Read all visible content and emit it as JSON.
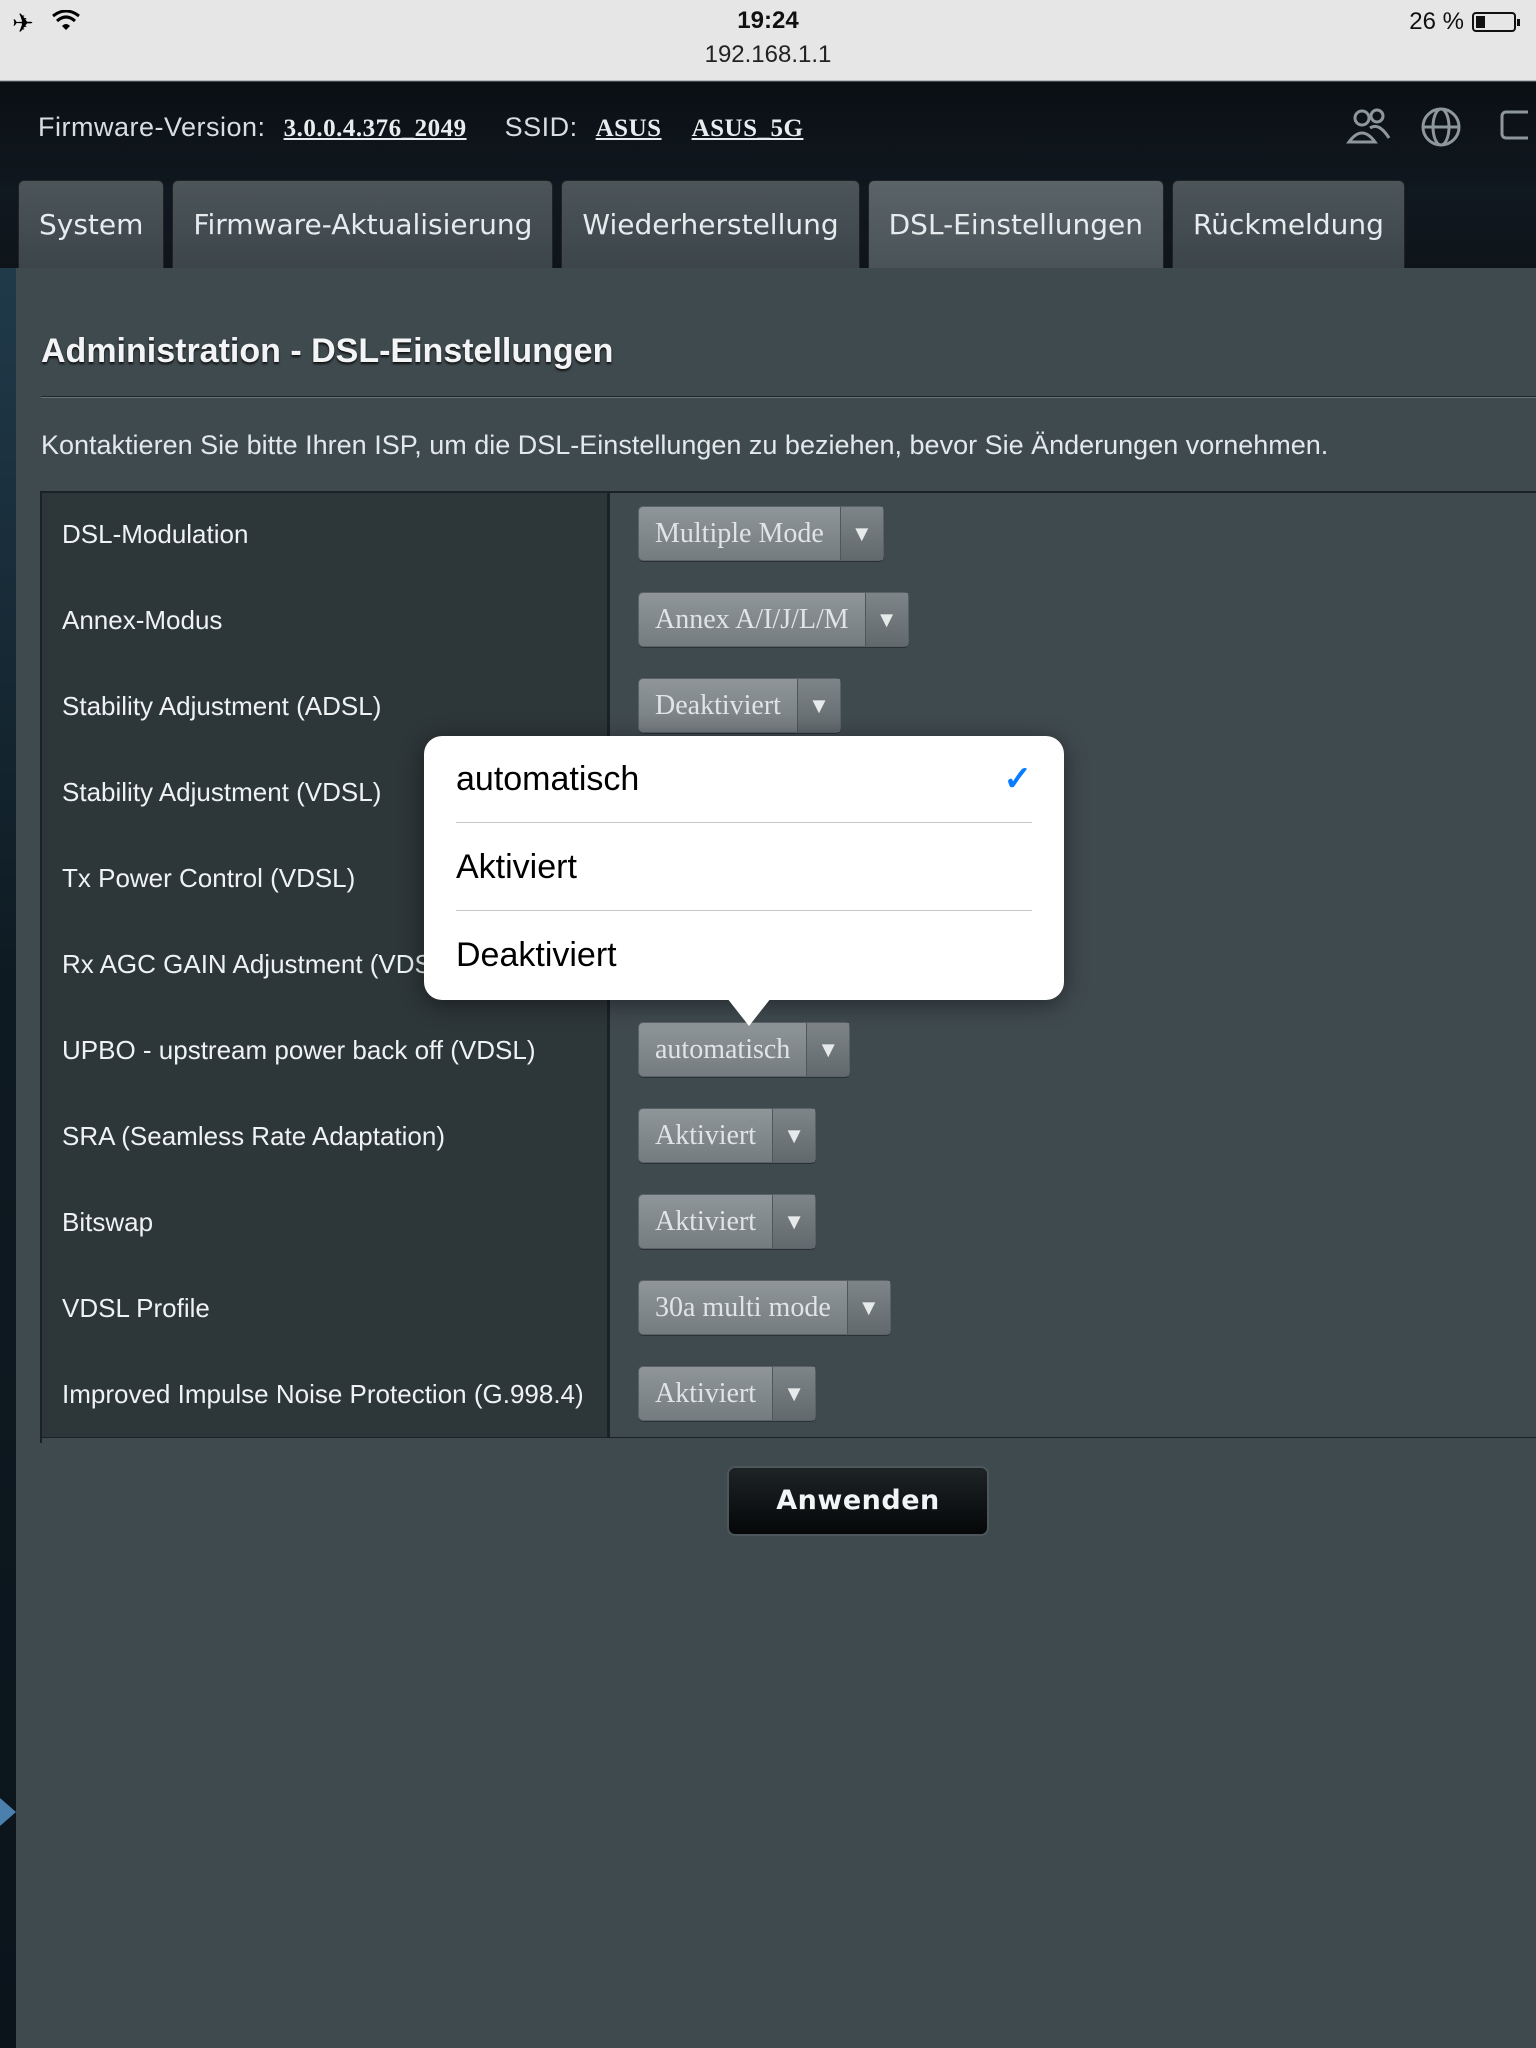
{
  "status_bar": {
    "time": "19:24",
    "url": "192.168.1.1",
    "battery_percent": "26 %",
    "battery_level": 0.26,
    "icons": [
      "airplane-icon",
      "wifi-icon",
      "battery-icon"
    ]
  },
  "header": {
    "firmware_label": "Firmware-Version:",
    "firmware_value": "3.0.0.4.376_2049",
    "ssid_label": "SSID:",
    "ssid_1": "ASUS",
    "ssid_2": "ASUS_5G",
    "icons": [
      "users-icon",
      "globe-icon",
      "monitor-icon"
    ]
  },
  "tabs": [
    {
      "label": "System"
    },
    {
      "label": "Firmware-Aktualisierung"
    },
    {
      "label": "Wiederherstellung"
    },
    {
      "label": "DSL-Einstellungen",
      "active": true
    },
    {
      "label": "Rückmeldung"
    }
  ],
  "page": {
    "title": "Administration - DSL-Einstellungen",
    "description": "Kontaktieren Sie bitte Ihren ISP, um die DSL-Einstellungen zu beziehen, bevor Sie Änderungen vornehmen."
  },
  "settings": [
    {
      "label": "DSL-Modulation",
      "value": "Multiple Mode"
    },
    {
      "label": "Annex-Modus",
      "value": "Annex A/I/J/L/M"
    },
    {
      "label": "Stability Adjustment (ADSL)",
      "value": "Deaktiviert"
    },
    {
      "label": "Stability Adjustment (VDSL)",
      "value": ""
    },
    {
      "label": "Tx Power Control (VDSL)",
      "value": ""
    },
    {
      "label": "Rx AGC GAIN Adjustment (VDSL)",
      "value": ""
    },
    {
      "label": "UPBO - upstream power back off (VDSL)",
      "value": "automatisch"
    },
    {
      "label": "SRA (Seamless Rate Adaptation)",
      "value": "Aktiviert"
    },
    {
      "label": "Bitswap",
      "value": "Aktiviert"
    },
    {
      "label": "VDSL Profile",
      "value": "30a multi mode"
    },
    {
      "label": "Improved Impulse Noise Protection (G.998.4)",
      "value": "Aktiviert"
    }
  ],
  "apply_button": "Anwenden",
  "popover": {
    "options": [
      {
        "label": "automatisch",
        "selected": true
      },
      {
        "label": "Aktiviert",
        "selected": false
      },
      {
        "label": "Deaktiviert",
        "selected": false
      }
    ],
    "check_glyph": "✓"
  },
  "colors": {
    "check_accent": "#0a7cff",
    "panel_bg": "#3f4a4f"
  }
}
